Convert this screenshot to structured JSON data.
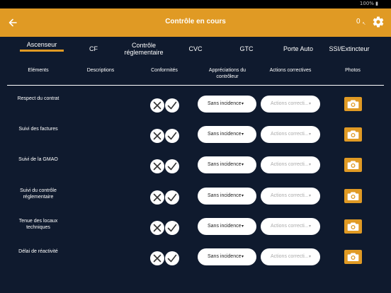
{
  "status": {
    "battery": "100% ▮"
  },
  "header": {
    "title": "Contrôle en cours",
    "back_icon": "arrow-left-icon",
    "count": "0",
    "count_suffix": "↖",
    "settings_icon": "gear-icon",
    "bg_color": "#e09a24"
  },
  "tabs": [
    {
      "label": "Ascenseur",
      "active": true
    },
    {
      "label": "CF",
      "active": false
    },
    {
      "label": "Contrôle réglementaire",
      "active": false
    },
    {
      "label": "CVC",
      "active": false
    },
    {
      "label": "GTC",
      "active": false
    },
    {
      "label": "Porte Auto",
      "active": false
    },
    {
      "label": "SSI/Extincteur",
      "active": false
    }
  ],
  "columns": {
    "elements": "Eléments",
    "descriptions": "Descriptions",
    "conformites": "Conformités",
    "appreciations": "Appréciations du contrôleur",
    "actions": "Actions correctives",
    "photos": "Photos"
  },
  "rows": [
    {
      "label": "Respect du contrat",
      "appreciation": "Sans incidence",
      "action_placeholder": "Actions correcti..."
    },
    {
      "label": "Suivi des factures",
      "appreciation": "Sans incidence",
      "action_placeholder": "Actions correcti..."
    },
    {
      "label": "Suivi de la GMAO",
      "appreciation": "Sans incidence",
      "action_placeholder": "Actions correcti..."
    },
    {
      "label": "Suivi du contrôle réglementaire",
      "appreciation": "Sans incidence",
      "action_placeholder": "Actions correcti..."
    },
    {
      "label": "Tenue des locaux techniques",
      "appreciation": "Sans incidence",
      "action_placeholder": "Actions correcti..."
    },
    {
      "label": "Délai de réactivité",
      "appreciation": "Sans incidence",
      "action_placeholder": "Actions correcti..."
    }
  ],
  "dropdown_caret": "▾",
  "colors": {
    "background": "#0f1a2e",
    "accent": "#e09a24"
  }
}
